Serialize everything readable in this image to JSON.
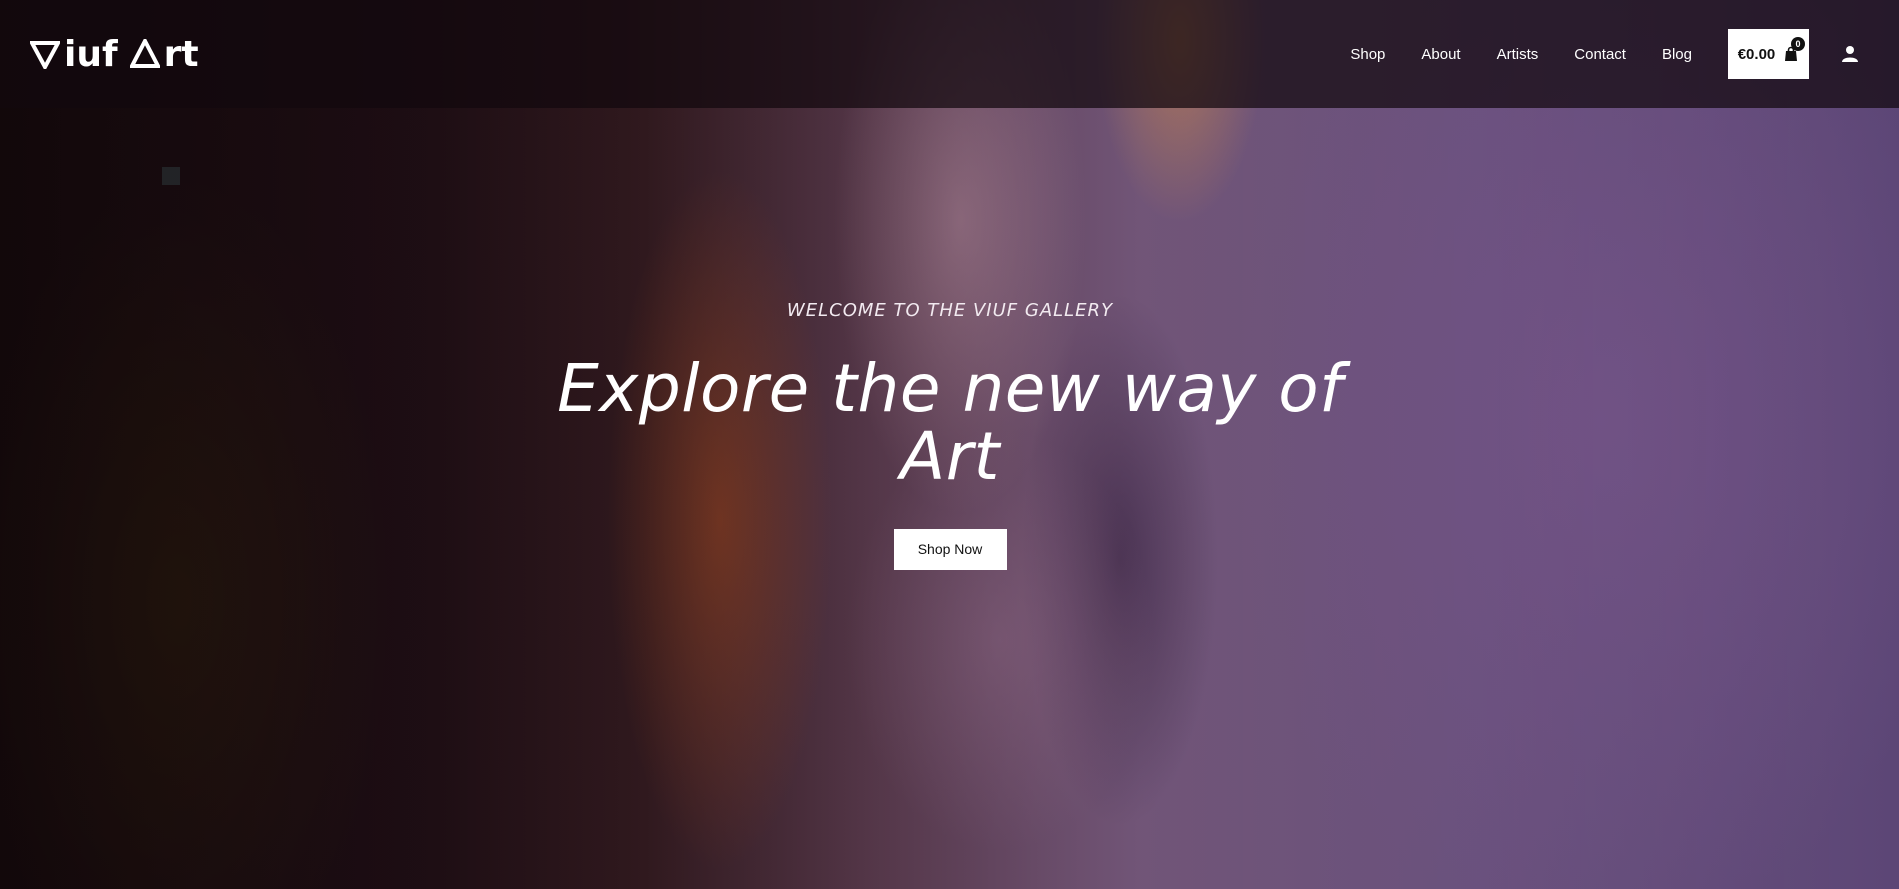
{
  "header": {
    "logo_text": "Viuf Art",
    "logo_parts": [
      "iuf",
      "rt"
    ],
    "nav": [
      {
        "label": "Shop"
      },
      {
        "label": "About"
      },
      {
        "label": "Artists"
      },
      {
        "label": "Contact"
      },
      {
        "label": "Blog"
      }
    ],
    "cart": {
      "total": "€0.00",
      "count": "0",
      "icon": "shopping-bag-icon"
    },
    "account_icon": "user-icon"
  },
  "hero": {
    "kicker": "WELCOME TO THE VIUF GALLERY",
    "headline": "Explore the new way of Art",
    "cta_label": "Shop Now"
  },
  "colors": {
    "header_bg": "#12080e",
    "accent_white": "#ffffff",
    "text_dark": "#111111"
  }
}
